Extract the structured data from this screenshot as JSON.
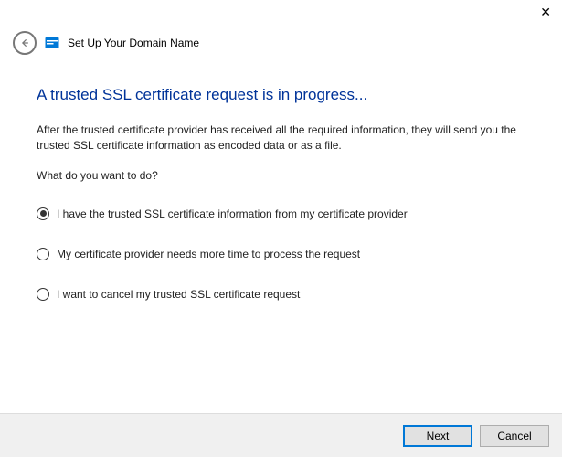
{
  "header": {
    "title": "Set Up Your Domain Name"
  },
  "page": {
    "heading": "A trusted SSL certificate request is in progress...",
    "description": "After the trusted certificate provider has received all the required information, they will send you the trusted SSL certificate information as encoded data or as a file.",
    "prompt": "What do you want to do?"
  },
  "options": [
    {
      "label": "I have the trusted SSL certificate information from my certificate provider",
      "selected": true
    },
    {
      "label": "My certificate provider needs more time to process the request",
      "selected": false
    },
    {
      "label": "I want to cancel my trusted SSL certificate request",
      "selected": false
    }
  ],
  "footer": {
    "next_label": "Next",
    "cancel_label": "Cancel"
  }
}
